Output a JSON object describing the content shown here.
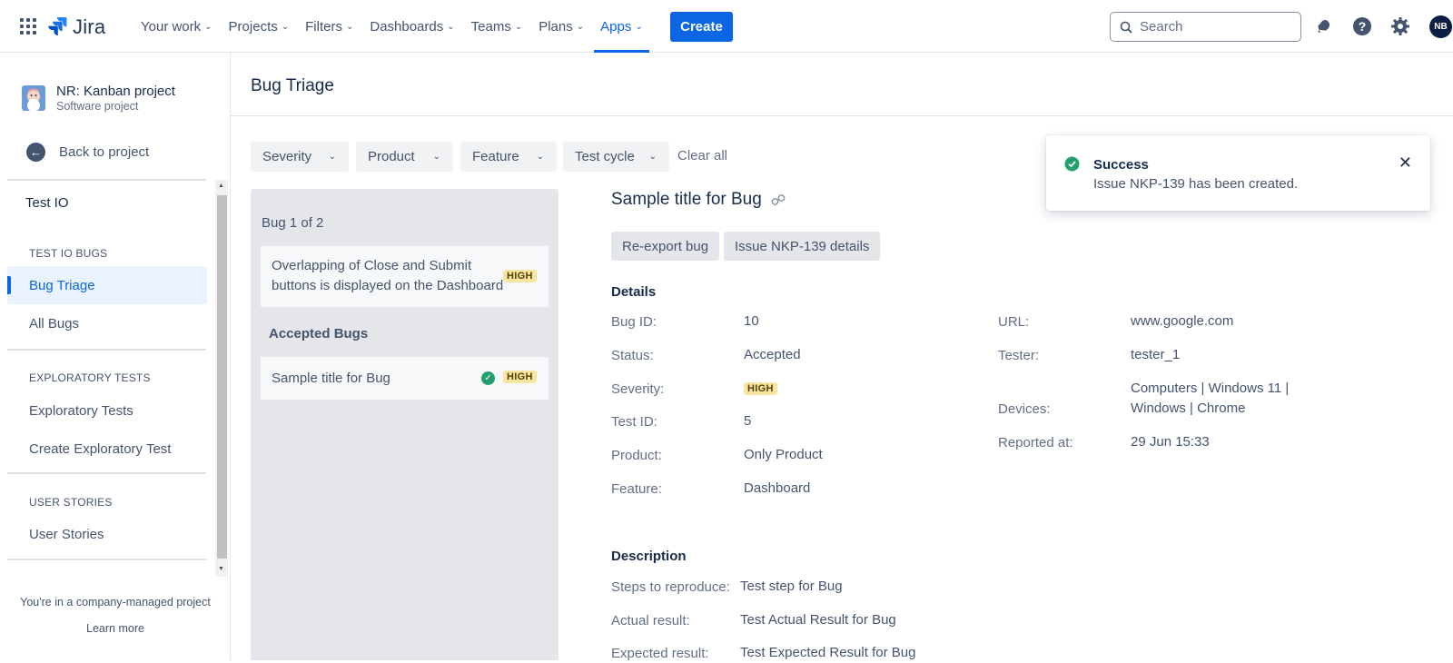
{
  "topnav": {
    "product": "Jira",
    "items": [
      {
        "label": "Your work"
      },
      {
        "label": "Projects"
      },
      {
        "label": "Filters"
      },
      {
        "label": "Dashboards"
      },
      {
        "label": "Teams"
      },
      {
        "label": "Plans"
      },
      {
        "label": "Apps"
      }
    ],
    "active_item": "Apps",
    "create_label": "Create",
    "search_placeholder": "Search",
    "avatar_initials": "NB",
    "accent_color": "#0c66e4"
  },
  "sidebar": {
    "project_name": "NR: Kanban project",
    "project_type": "Software project",
    "back_label": "Back to project",
    "section_title": "Test IO",
    "groups": [
      {
        "heading": "TEST IO BUGS",
        "items": [
          "Bug Triage",
          "All Bugs"
        ]
      },
      {
        "heading": "EXPLORATORY TESTS",
        "items": [
          "Exploratory Tests",
          "Create Exploratory Test"
        ]
      },
      {
        "heading": "USER STORIES",
        "items": [
          "User Stories"
        ]
      }
    ],
    "active_item": "Bug Triage",
    "footnote": "You're in a company-managed project",
    "learn_more": "Learn more"
  },
  "main": {
    "title": "Bug Triage",
    "filters": [
      "Severity",
      "Product",
      "Feature",
      "Test cycle"
    ],
    "clear_all": "Clear all",
    "bug_list": {
      "count_label": "Bug 1 of 2",
      "bugs": [
        {
          "title_line1": "Overlapping of Close and Submit",
          "title_line2": "buttons is displayed on the Dashboard",
          "severity": "HIGH"
        }
      ],
      "accepted_heading": "Accepted Bugs",
      "accepted": [
        {
          "title": "Sample title for Bug",
          "severity": "HIGH"
        }
      ]
    },
    "detail": {
      "title": "Sample title for Bug",
      "buttons": [
        "Re-export bug",
        "Issue NKP-139 details"
      ],
      "details_heading": "Details",
      "left_fields": [
        {
          "label": "Bug ID:",
          "value": "10"
        },
        {
          "label": "Status:",
          "value": "Accepted"
        },
        {
          "label": "Severity:",
          "value": "HIGH"
        },
        {
          "label": "Test ID:",
          "value": "5"
        },
        {
          "label": "Product:",
          "value": "Only Product"
        },
        {
          "label": "Feature:",
          "value": "Dashboard"
        }
      ],
      "right_fields": [
        {
          "label": "URL:",
          "value": "www.google.com"
        },
        {
          "label": "Tester:",
          "value": "tester_1"
        },
        {
          "label": "Devices:",
          "value_line1": "Computers | Windows 11 |",
          "value_line2": "Windows | Chrome"
        },
        {
          "label": "Reported at:",
          "value": "29 Jun 15:33"
        }
      ],
      "description_heading": "Description",
      "description_fields": [
        {
          "label": "Steps to reproduce:",
          "value": "Test step for Bug"
        },
        {
          "label": "Actual result:",
          "value": "Test Actual Result for Bug"
        },
        {
          "label": "Expected result:",
          "value": "Test Expected Result for Bug"
        }
      ]
    }
  },
  "toast": {
    "title": "Success",
    "message": "Issue NKP-139 has been created.",
    "status_color": "#22a06b"
  }
}
